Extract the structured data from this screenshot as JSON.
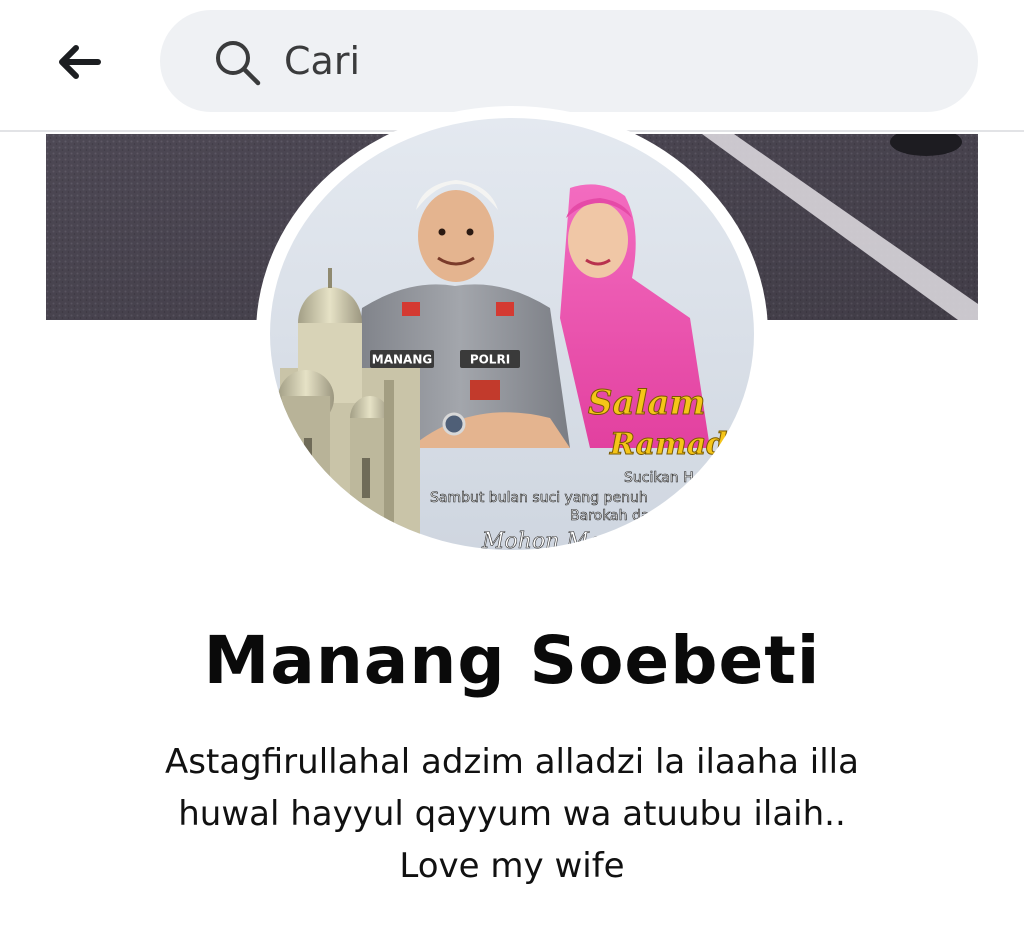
{
  "search": {
    "placeholder": "Cari"
  },
  "profile": {
    "name": "Manang Soebeti",
    "bio_lines": [
      "Astagfirullahal adzim alladzi la ilaaha illa",
      "huwal hayyul qayyum wa atuubu ilaih..",
      "Love my wife"
    ]
  },
  "avatar_image_text": {
    "name_tag": "MANANG",
    "uniform_tag": "POLRI",
    "greeting_title_1": "Salam",
    "greeting_title_2": "Ramadhan",
    "greeting_line_1": "Sucikan H",
    "greeting_line_2": "Sambut bulan suci yang penuh",
    "greeting_line_3": "Barokah dan A",
    "greeting_signoff": "Mohon Maaf"
  },
  "icons": {
    "back": "arrow-left-icon",
    "search": "search-icon"
  },
  "colors": {
    "search_bg": "#eff1f4",
    "divider": "#e2e3e6",
    "cover_asphalt": "#4f4a55",
    "pink_hijab": "#ee4fb0",
    "uniform": "#8d9095",
    "greeting_gold": "#f5c518"
  }
}
